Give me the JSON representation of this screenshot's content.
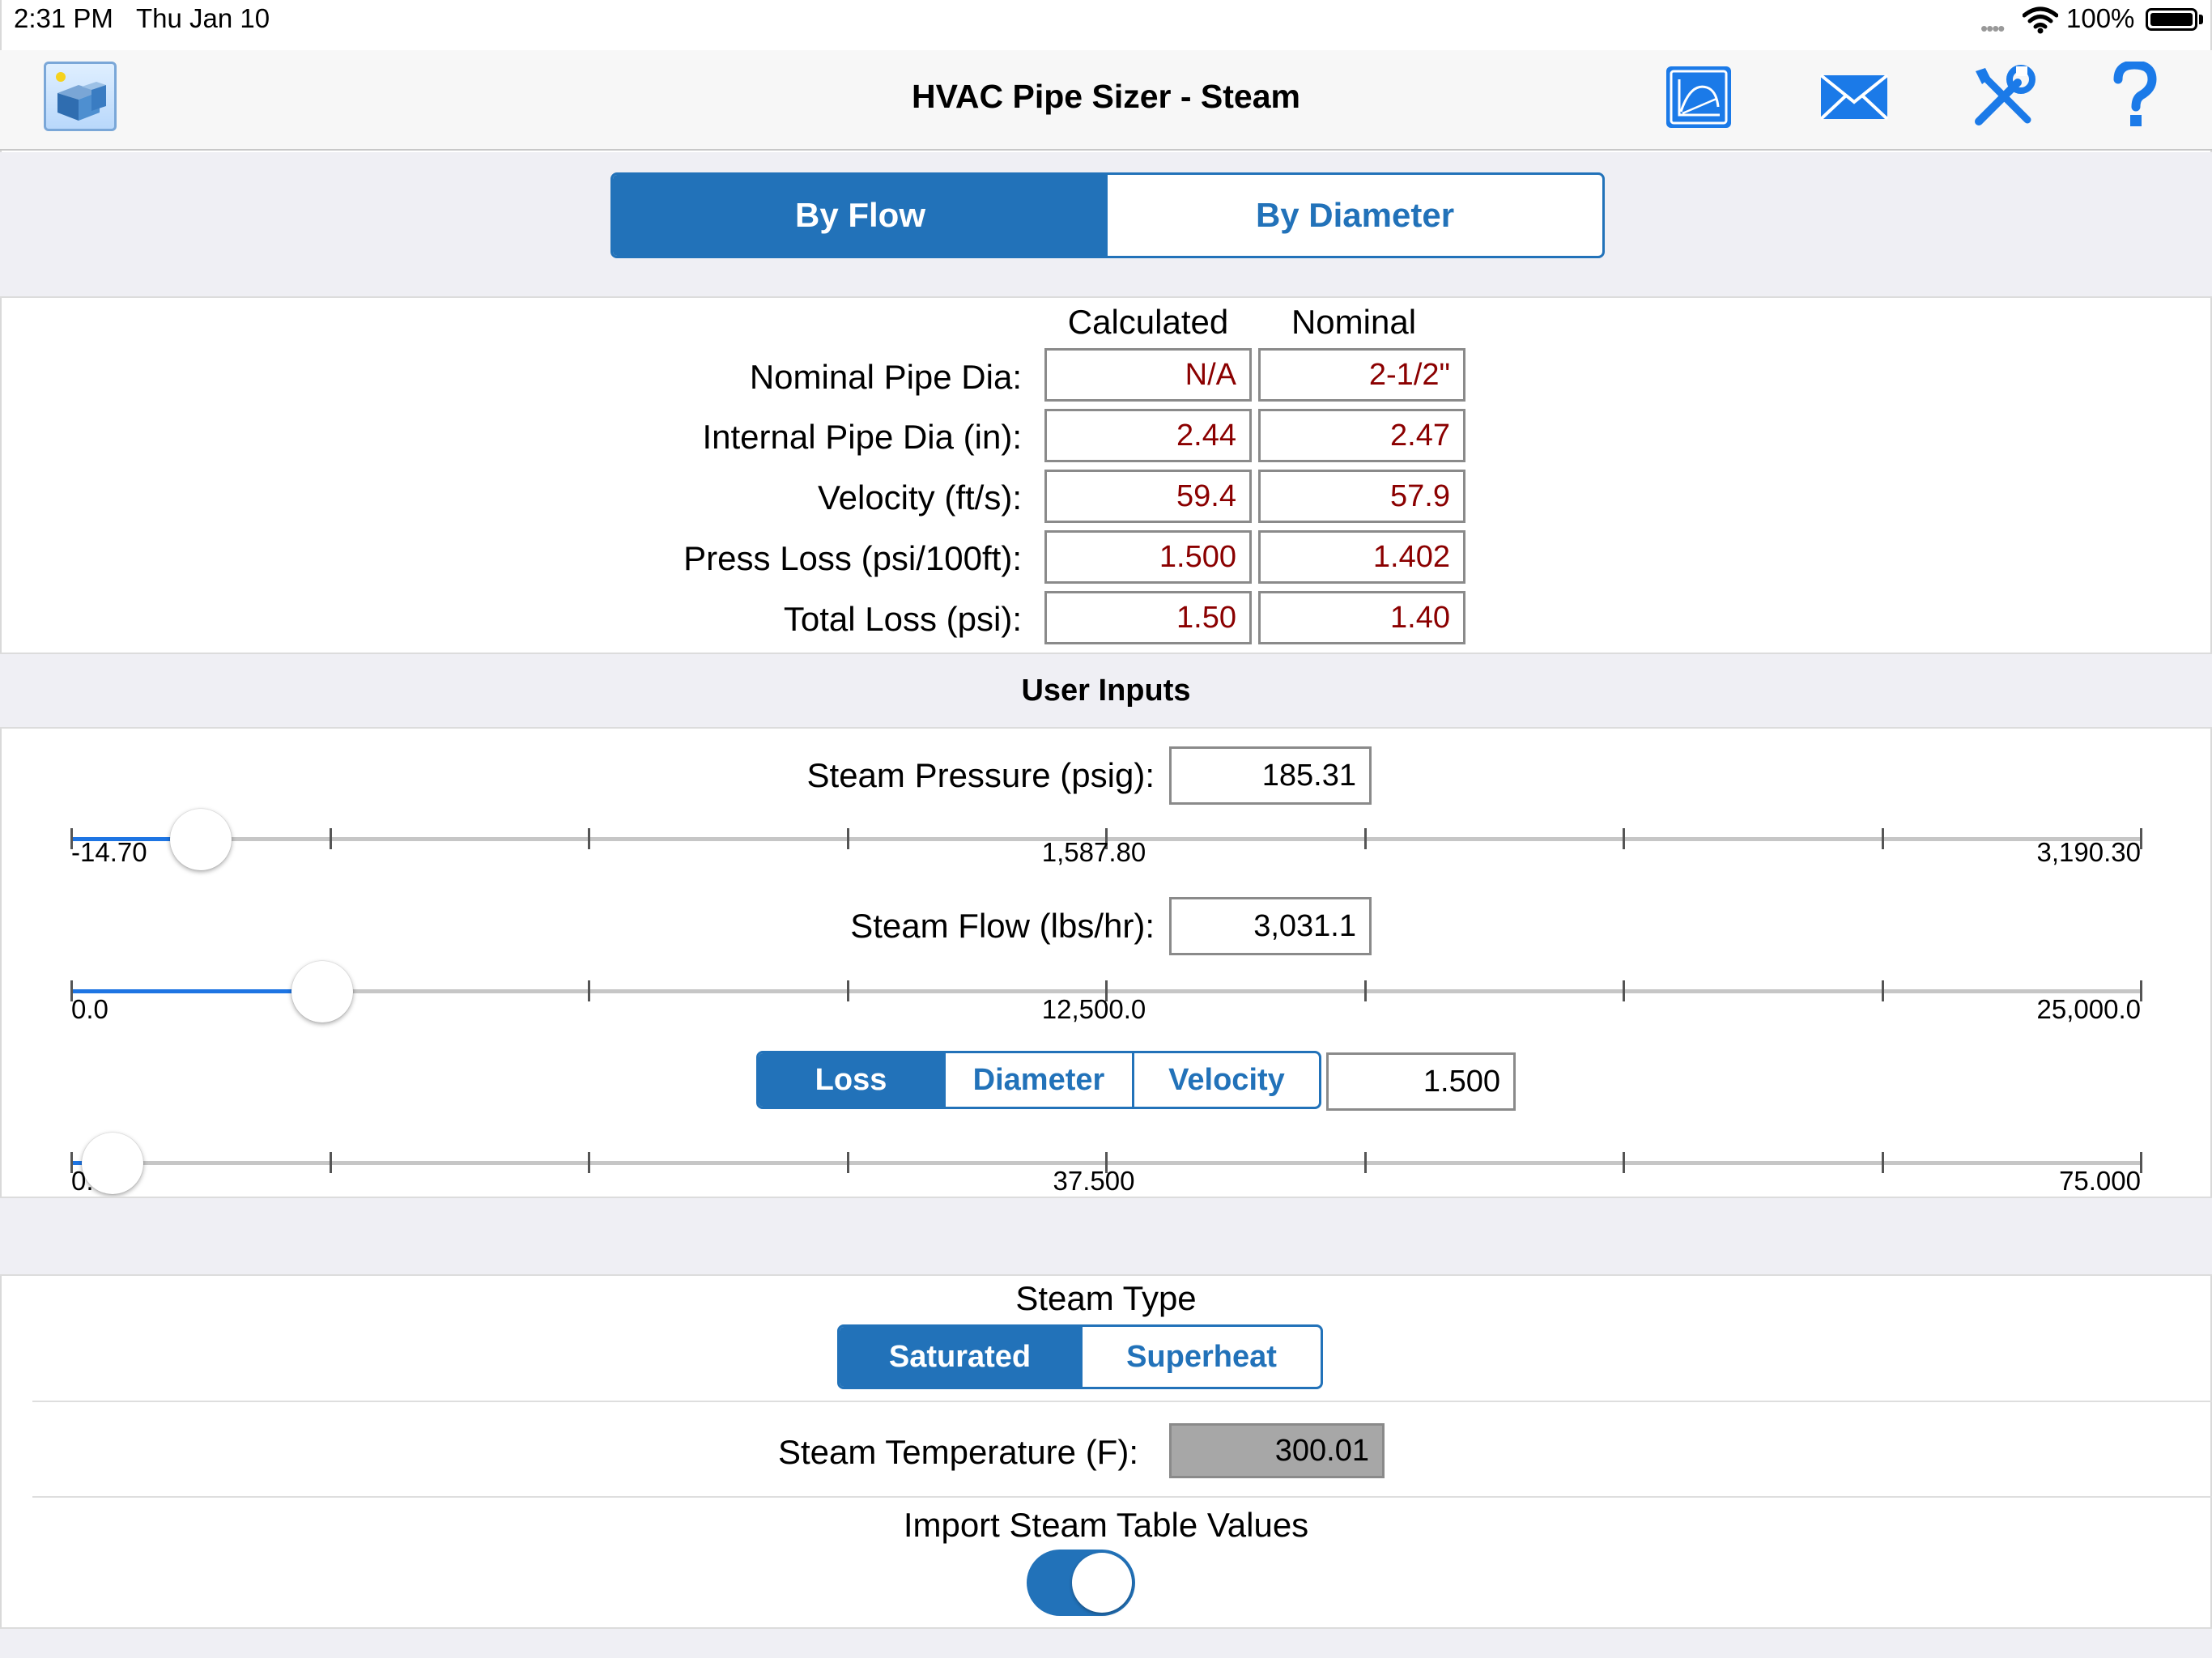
{
  "status_bar": {
    "time": "2:31 PM",
    "date": "Thu Jan 10",
    "battery": "100%"
  },
  "nav": {
    "title": "HVAC Pipe Sizer - Steam"
  },
  "mode_tabs": [
    {
      "label": "By Flow",
      "selected": true
    },
    {
      "label": "By Diameter",
      "selected": false
    }
  ],
  "results": {
    "columns": [
      "Calculated",
      "Nominal"
    ],
    "rows": [
      {
        "label": "Nominal Pipe Dia:",
        "calculated": "N/A",
        "nominal": "2-1/2\""
      },
      {
        "label": "Internal Pipe Dia (in):",
        "calculated": "2.44",
        "nominal": "2.47"
      },
      {
        "label": "Velocity (ft/s):",
        "calculated": "59.4",
        "nominal": "57.9"
      },
      {
        "label": "Press Loss (psi/100ft):",
        "calculated": "1.500",
        "nominal": "1.402"
      },
      {
        "label": "Total Loss (psi):",
        "calculated": "1.50",
        "nominal": "1.40"
      }
    ]
  },
  "user_inputs": {
    "title": "User Inputs",
    "steam_pressure": {
      "label": "Steam Pressure (psig):",
      "value": "185.31",
      "min": "-14.70",
      "mid": "1,587.80",
      "max": "3,190.30",
      "fraction": 0.0626
    },
    "steam_flow": {
      "label": "Steam Flow (lbs/hr):",
      "value": "3,031.1",
      "min": "0.0",
      "mid": "12,500.0",
      "max": "25,000.0",
      "fraction": 0.1212
    },
    "criteria": {
      "tabs": [
        {
          "label": "Loss",
          "selected": true
        },
        {
          "label": "Diameter",
          "selected": false
        },
        {
          "label": "Velocity",
          "selected": false
        }
      ],
      "value": "1.500",
      "min": "0.000",
      "mid": "37.500",
      "max": "75.000",
      "fraction": 0.02
    }
  },
  "steam_type": {
    "label": "Steam Type",
    "tabs": [
      {
        "label": "Saturated",
        "selected": true
      },
      {
        "label": "Superheat",
        "selected": false
      }
    ]
  },
  "steam_temperature": {
    "label": "Steam Temperature (F):",
    "value": "300.01"
  },
  "import_steam_table": {
    "label": "Import Steam Table Values",
    "on": true
  },
  "colors": {
    "accent": "#2272b9",
    "slider_fill": "#1e75e3",
    "value_text": "#8b0000"
  }
}
